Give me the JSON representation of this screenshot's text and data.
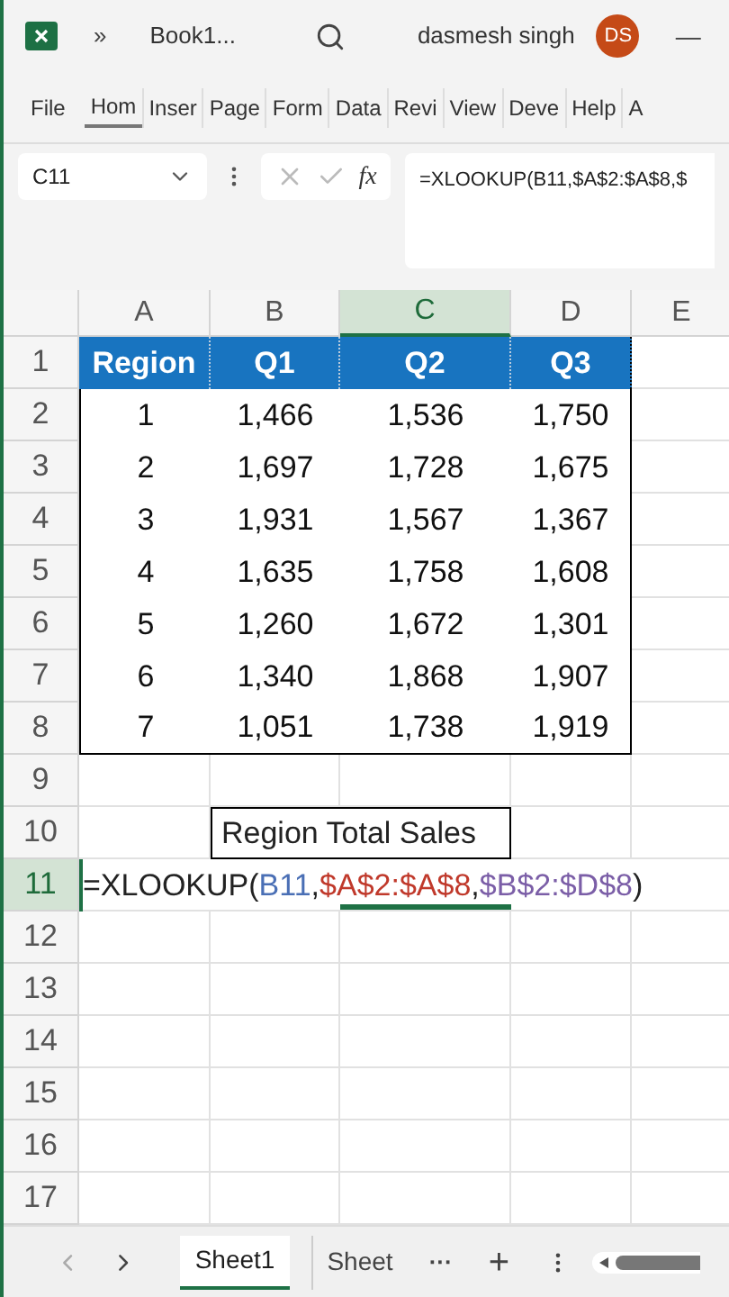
{
  "title_bar": {
    "more": "»",
    "title": "Book1...",
    "user": "dasmesh singh",
    "initials": "DS",
    "minimize": "—"
  },
  "ribbon_tabs": [
    {
      "label": "File",
      "selected": false
    },
    {
      "label": "Hom",
      "selected": true
    },
    {
      "label": "Inser",
      "selected": false
    },
    {
      "label": "Page",
      "selected": false
    },
    {
      "label": "Form",
      "selected": false
    },
    {
      "label": "Data",
      "selected": false
    },
    {
      "label": "Revi",
      "selected": false
    },
    {
      "label": "View",
      "selected": false
    },
    {
      "label": "Deve",
      "selected": false
    },
    {
      "label": "Help",
      "selected": false
    },
    {
      "label": "A",
      "selected": false
    }
  ],
  "formula_bar": {
    "name_box": "C11",
    "fx": "fx",
    "formula": "=XLOOKUP(B11,$A$2:$A$8,$"
  },
  "columns": [
    {
      "label": "A",
      "selected": false
    },
    {
      "label": "B",
      "selected": false
    },
    {
      "label": "C",
      "selected": true
    },
    {
      "label": "D",
      "selected": false
    },
    {
      "label": "E",
      "selected": false
    }
  ],
  "table": {
    "header": [
      "Region",
      "Q1",
      "Q2",
      "Q3"
    ],
    "rows": [
      [
        "1",
        "1,466",
        "1,536",
        "1,750"
      ],
      [
        "2",
        "1,697",
        "1,728",
        "1,675"
      ],
      [
        "3",
        "1,931",
        "1,567",
        "1,367"
      ],
      [
        "4",
        "1,635",
        "1,758",
        "1,608"
      ],
      [
        "5",
        "1,260",
        "1,672",
        "1,301"
      ],
      [
        "6",
        "1,340",
        "1,868",
        "1,907"
      ],
      [
        "7",
        "1,051",
        "1,738",
        "1,919"
      ]
    ]
  },
  "row_numbers": [
    {
      "label": "1",
      "selected": false
    },
    {
      "label": "2",
      "selected": false
    },
    {
      "label": "3",
      "selected": false
    },
    {
      "label": "4",
      "selected": false
    },
    {
      "label": "5",
      "selected": false
    },
    {
      "label": "6",
      "selected": false
    },
    {
      "label": "7",
      "selected": false
    },
    {
      "label": "8",
      "selected": false
    },
    {
      "label": "9",
      "selected": false
    },
    {
      "label": "10",
      "selected": false
    },
    {
      "label": "11",
      "selected": true
    },
    {
      "label": "12",
      "selected": false
    },
    {
      "label": "13",
      "selected": false
    },
    {
      "label": "14",
      "selected": false
    },
    {
      "label": "15",
      "selected": false
    },
    {
      "label": "16",
      "selected": false
    },
    {
      "label": "17",
      "selected": false
    }
  ],
  "label_cell": "Region Total Sales",
  "formula_cell": [
    {
      "text": "=XLOOKUP(",
      "color": "#222222"
    },
    {
      "text": "B11",
      "color": "#4a6fb5"
    },
    {
      "text": ",",
      "color": "#222222"
    },
    {
      "text": "$A$2:$A$8",
      "color": "#c0392b"
    },
    {
      "text": ",",
      "color": "#222222"
    },
    {
      "text": "$B$2:$D$8",
      "color": "#7b5ea7"
    },
    {
      "text": ")",
      "color": "#222222"
    }
  ],
  "sheet_tabs": [
    {
      "label": "Sheet1",
      "selected": true
    },
    {
      "label": "Sheet",
      "selected": false
    }
  ],
  "sheet_more": "···",
  "sheet_add": "+"
}
